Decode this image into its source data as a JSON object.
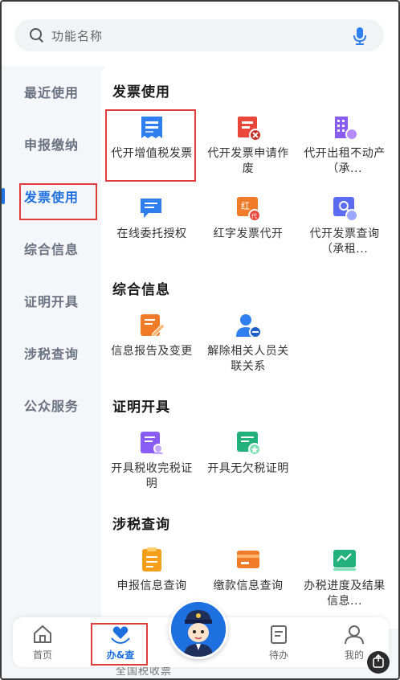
{
  "search": {
    "placeholder": "功能名称"
  },
  "sidebar": {
    "items": [
      {
        "label": "最近使用"
      },
      {
        "label": "申报缴纳"
      },
      {
        "label": "发票使用"
      },
      {
        "label": "综合信息"
      },
      {
        "label": "证明开具"
      },
      {
        "label": "涉税查询"
      },
      {
        "label": "公众服务"
      }
    ],
    "active_index": 2
  },
  "sections": [
    {
      "title": "发票使用",
      "tiles": [
        {
          "label": "代开增值税发票",
          "icon": "invoice-icon"
        },
        {
          "label": "代开发票申请作废",
          "icon": "invoice-void-icon"
        },
        {
          "label": "代开出租不动产（承...",
          "icon": "building-icon"
        },
        {
          "label": "在线委托授权",
          "icon": "chat-authorize-icon"
        },
        {
          "label": "红字发票代开",
          "icon": "red-invoice-icon"
        },
        {
          "label": "代开发票查询（承租...",
          "icon": "invoice-search-icon"
        }
      ]
    },
    {
      "title": "综合信息",
      "tiles": [
        {
          "label": "信息报告及变更",
          "icon": "edit-report-icon"
        },
        {
          "label": "解除相关人员关联关系",
          "icon": "remove-person-icon"
        }
      ]
    },
    {
      "title": "证明开具",
      "tiles": [
        {
          "label": "开具税收完税证明",
          "icon": "tax-certificate-icon"
        },
        {
          "label": "开具无欠税证明",
          "icon": "no-arrears-certificate-icon"
        }
      ]
    },
    {
      "title": "涉税查询",
      "tiles": [
        {
          "label": "申报信息查询",
          "icon": "declaration-query-icon"
        },
        {
          "label": "缴款信息查询",
          "icon": "payment-query-icon"
        },
        {
          "label": "办税进度及结果信息...",
          "icon": "progress-query-icon"
        }
      ]
    }
  ],
  "peek_text": "全国税收票",
  "bottom_nav": {
    "items": [
      {
        "label": "首页",
        "icon": "home-icon"
      },
      {
        "label": "办&查",
        "icon": "heart-hands-icon"
      },
      {
        "label": "待办",
        "icon": "todo-icon"
      },
      {
        "label": "我的",
        "icon": "user-icon"
      }
    ],
    "active_index": 1
  },
  "colors": {
    "accent": "#1e6fe0",
    "highlight_box": "#e03c3c",
    "icon_blue": "#2f7ff0",
    "icon_red": "#e8473a",
    "icon_purple": "#8a5cf6",
    "icon_orange": "#f07c2a",
    "icon_green": "#22b07d"
  }
}
